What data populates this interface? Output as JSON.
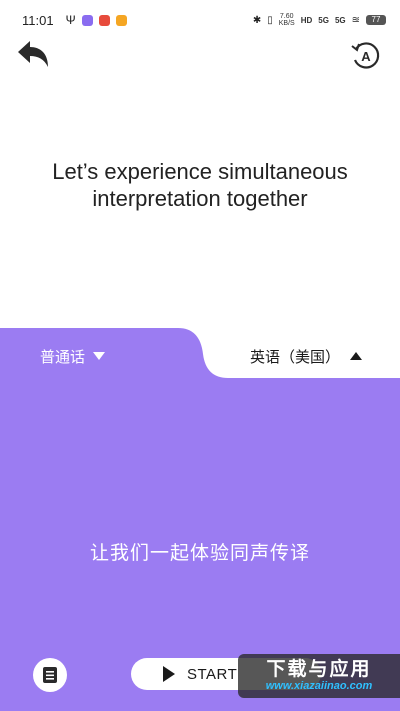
{
  "status_bar": {
    "time": "11:01",
    "net_speed_value": "7.60",
    "net_speed_unit": "KB/S",
    "hd_badge": "HD",
    "signal_1": "5G",
    "signal_2": "5G",
    "battery": "77"
  },
  "header": {
    "back_icon": "back-arrow-icon",
    "translate_icon": "auto-translate-icon"
  },
  "intro": {
    "line1": "Let’s experience simultaneous",
    "line2": "interpretation together"
  },
  "languages": {
    "source": "普通话",
    "target": "英语（美国）"
  },
  "panel": {
    "text": "让我们一起体验同声传译",
    "start_label": "START"
  },
  "watermark": {
    "title": "下载与应用",
    "url": "www.xiazaiinao.com"
  },
  "colors": {
    "purple": "#9b7cf2",
    "white": "#ffffff",
    "text": "#1a1a1a"
  }
}
